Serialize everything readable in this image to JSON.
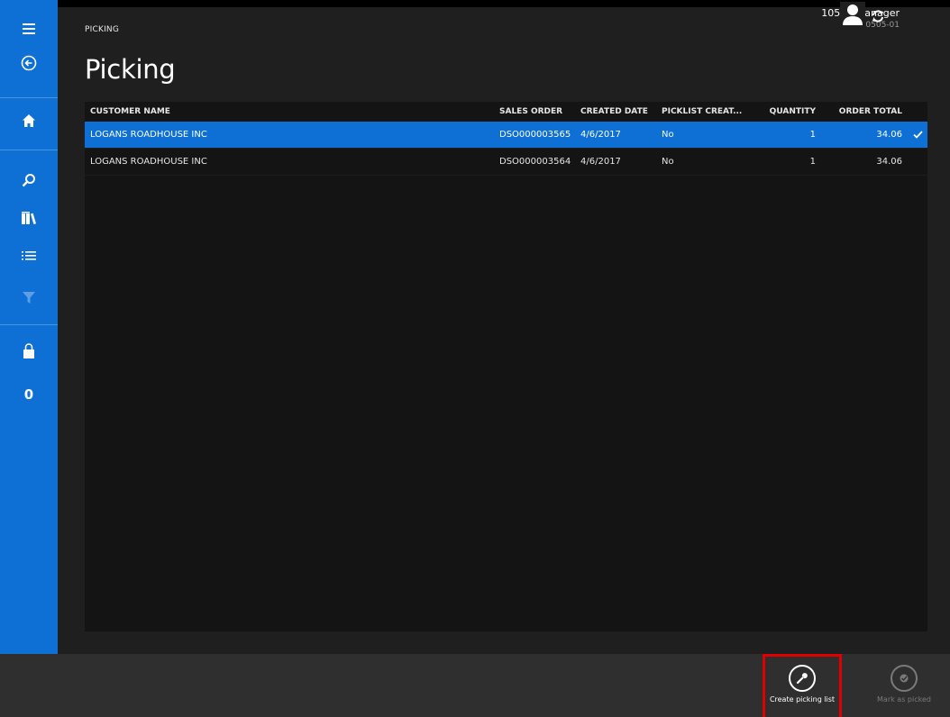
{
  "nav": {
    "count": "0"
  },
  "header": {
    "breadcrumb": "PICKING",
    "title": "Picking",
    "user_name": "10505 Manager",
    "user_store": "1 - 10505-01"
  },
  "grid": {
    "columns": [
      "CUSTOMER NAME",
      "SALES ORDER",
      "CREATED DATE",
      "PICKLIST CREAT...",
      "QUANTITY",
      "ORDER TOTAL"
    ],
    "rows": [
      {
        "customer": "LOGANS ROADHOUSE INC",
        "sales_order": "DSO000003565",
        "created": "4/6/2017",
        "picklist": "No",
        "quantity": "1",
        "total": "34.06",
        "selected": true
      },
      {
        "customer": "LOGANS ROADHOUSE INC",
        "sales_order": "DSO000003564",
        "created": "4/6/2017",
        "picklist": "No",
        "quantity": "1",
        "total": "34.06",
        "selected": false
      }
    ]
  },
  "appbar": {
    "create_label": "Create picking list",
    "mark_label": "Mark as picked"
  },
  "colors": {
    "accent": "#0e6fd4",
    "highlight": "#e00000"
  }
}
